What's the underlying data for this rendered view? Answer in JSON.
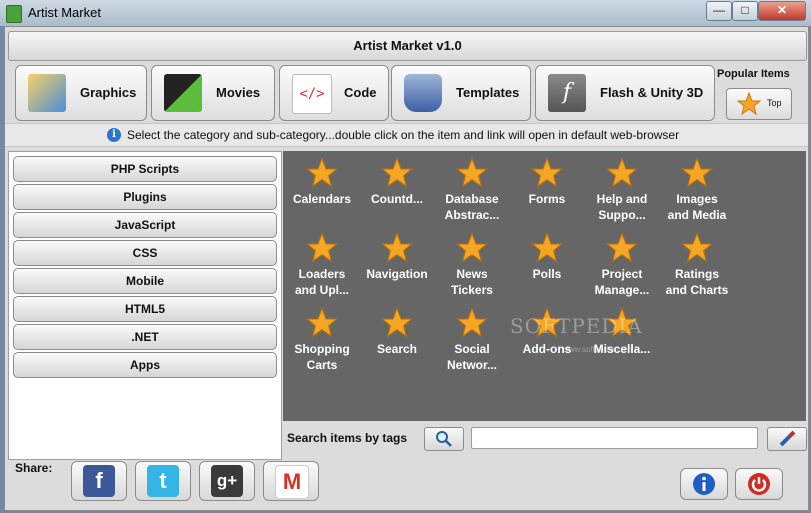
{
  "window": {
    "title": "Artist Market",
    "minimize": "—",
    "maximize": "□",
    "close": "✕"
  },
  "header": {
    "title": "Artist Market v1.0"
  },
  "categories": [
    {
      "label": "Graphics",
      "icon": "graphics-icon"
    },
    {
      "label": "Movies",
      "icon": "movies-icon"
    },
    {
      "label": "Code",
      "icon": "code-icon"
    },
    {
      "label": "Templates",
      "icon": "templates-icon"
    },
    {
      "label": "Flash & Unity 3D",
      "icon": "flash-icon"
    }
  ],
  "popular": {
    "label": "Popular Items",
    "top_label": "Top"
  },
  "hint": {
    "text": "Select the category and sub-category...double click on the item and link will open in default web-browser"
  },
  "subcategories": [
    "PHP Scripts",
    "Plugins",
    "JavaScript",
    "CSS",
    "Mobile",
    "HTML5",
    ".NET",
    "Apps"
  ],
  "items": [
    {
      "line1": "Calendars",
      "line2": ""
    },
    {
      "line1": "Countd...",
      "line2": ""
    },
    {
      "line1": "Database",
      "line2": "Abstrac..."
    },
    {
      "line1": "Forms",
      "line2": ""
    },
    {
      "line1": "Help and",
      "line2": "Suppo..."
    },
    {
      "line1": "Images",
      "line2": "and Media"
    },
    {
      "line1": "Loaders",
      "line2": "and Upl..."
    },
    {
      "line1": "Navigation",
      "line2": ""
    },
    {
      "line1": "News",
      "line2": "Tickers"
    },
    {
      "line1": "Polls",
      "line2": ""
    },
    {
      "line1": "Project",
      "line2": "Manage..."
    },
    {
      "line1": "Ratings",
      "line2": "and Charts"
    },
    {
      "line1": "Shopping",
      "line2": "Carts"
    },
    {
      "line1": "Search",
      "line2": ""
    },
    {
      "line1": "Social",
      "line2": "Networ..."
    },
    {
      "line1": "Add-ons",
      "line2": ""
    },
    {
      "line1": "Miscella...",
      "line2": ""
    }
  ],
  "watermark": {
    "text": "SOFTPEDIA",
    "small": "www.softpedia.com"
  },
  "search": {
    "label": "Search items by tags",
    "value": "",
    "placeholder": ""
  },
  "share": {
    "label": "Share:",
    "buttons": [
      {
        "name": "facebook",
        "glyph": "f",
        "color": "#3b5998"
      },
      {
        "name": "twitter",
        "glyph": "t",
        "color": "#33b5e5"
      },
      {
        "name": "google-plus",
        "glyph": "g+",
        "color": "#3a3a3a"
      },
      {
        "name": "gmail",
        "glyph": "M",
        "color": "#d93025"
      }
    ]
  },
  "colors": {
    "star": "#f5a623",
    "panel": "#666666",
    "info": "#1f5fc4",
    "power": "#d12a1f"
  }
}
